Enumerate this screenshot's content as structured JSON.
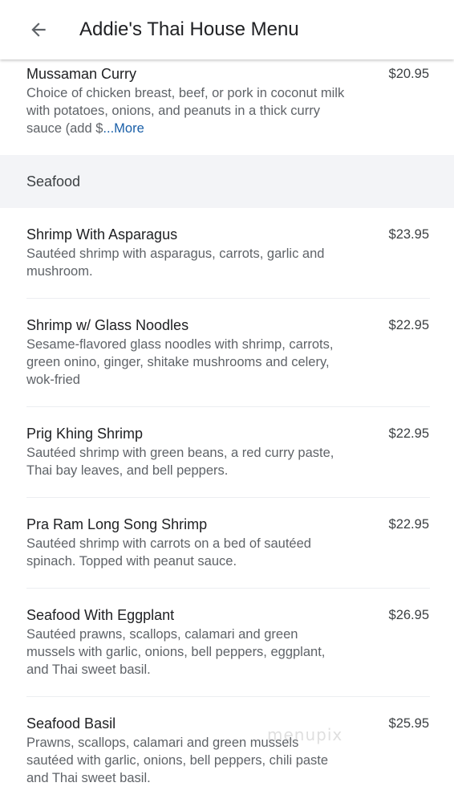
{
  "header": {
    "back_icon": "arrow-left-icon",
    "title": "Addie's Thai House Menu"
  },
  "top_item": {
    "name": "Mussaman Curry",
    "price": "$20.95",
    "desc_lines": [
      "Choice of chicken breast, beef, or pork in coconut milk",
      "with potatoes, onions, and peanuts in a thick curry",
      "sauce (add $"
    ],
    "more_label": "...More"
  },
  "section": {
    "title": "Seafood"
  },
  "items": [
    {
      "name": "Shrimp With Asparagus",
      "price": "$23.95",
      "desc_lines": [
        "Sautéed shrimp with asparagus, carrots, garlic and",
        "mushroom."
      ]
    },
    {
      "name": "Shrimp w/ Glass Noodles",
      "price": "$22.95",
      "desc_lines": [
        "Sesame-flavored glass noodles with shrimp, carrots,",
        "green onino, ginger, shitake mushrooms and celery,",
        "wok-fried"
      ]
    },
    {
      "name": "Prig Khing Shrimp",
      "price": "$22.95",
      "desc_lines": [
        "Sautéed shrimp with green beans, a red curry paste,",
        "Thai bay leaves, and bell peppers."
      ]
    },
    {
      "name": "Pra Ram Long Song Shrimp",
      "price": "$22.95",
      "desc_lines": [
        "Sautéed shrimp with carrots on a bed of sautéed",
        "spinach. Topped with peanut sauce."
      ]
    },
    {
      "name": "Seafood With Eggplant",
      "price": "$26.95",
      "desc_lines": [
        "Sautéed prawns, scallops, calamari and green",
        "mussels with garlic, onions, bell peppers, eggplant,",
        "and Thai sweet basil."
      ]
    },
    {
      "name": "Seafood Basil",
      "price": "$25.95",
      "desc_lines": [
        "Prawns, scallops, calamari and green mussels",
        "sautéed with garlic, onions, bell peppers, chili paste",
        "and Thai sweet basil."
      ]
    }
  ],
  "watermark": "menupix",
  "colors": {
    "section_bg": "#f3f4f7",
    "more_link": "#1a5fa8",
    "description": "#5f6368"
  }
}
